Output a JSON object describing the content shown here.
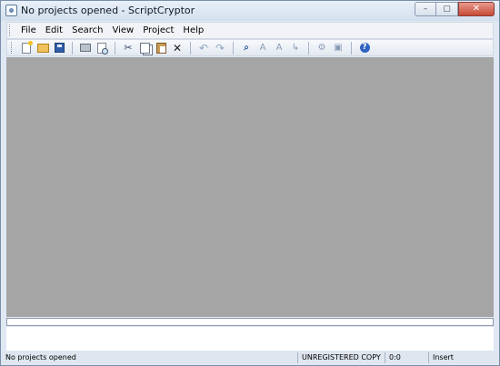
{
  "window": {
    "title": "No projects opened - ScriptCryptor",
    "app_icon": "scriptcryptor-icon"
  },
  "caption_buttons": {
    "minimize": "–",
    "maximize": "▢",
    "close": "✕"
  },
  "menu": {
    "items": [
      "File",
      "Edit",
      "Search",
      "View",
      "Project",
      "Help"
    ]
  },
  "toolbar": {
    "buttons": [
      {
        "name": "new-icon"
      },
      {
        "name": "open-icon"
      },
      {
        "name": "save-icon"
      },
      {
        "name": "print-icon"
      },
      {
        "name": "print-preview-icon"
      },
      {
        "name": "cut-icon",
        "glyph": "✂"
      },
      {
        "name": "copy-icon"
      },
      {
        "name": "paste-icon"
      },
      {
        "name": "delete-icon",
        "glyph": "✕"
      },
      {
        "name": "undo-icon",
        "glyph": "↶"
      },
      {
        "name": "redo-icon",
        "glyph": "↷"
      },
      {
        "name": "find-icon",
        "glyph": "⌕"
      },
      {
        "name": "find-next-icon",
        "glyph": "A"
      },
      {
        "name": "replace-icon",
        "glyph": "A"
      },
      {
        "name": "goto-icon",
        "glyph": "↳"
      },
      {
        "name": "compile-icon",
        "glyph": "⚙"
      },
      {
        "name": "project-options-icon",
        "glyph": "▣"
      },
      {
        "name": "help-icon",
        "glyph": "?"
      }
    ]
  },
  "statusbar": {
    "message": "No projects opened",
    "registration": "UNREGISTERED COPY",
    "position": "0:0",
    "mode": "Insert"
  },
  "colors": {
    "workspace": "#a5a5a5",
    "window_frame": "#dfe8f3",
    "close_button": "#c74a35"
  }
}
